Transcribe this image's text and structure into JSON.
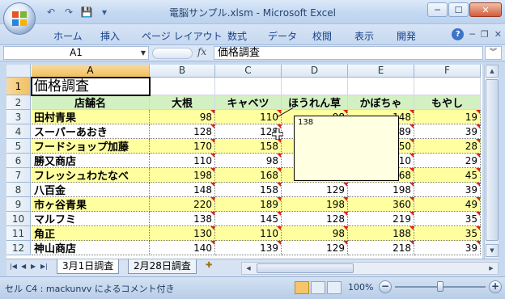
{
  "window": {
    "title": "電脳サンプル.xlsm - Microsoft Excel",
    "controls": {
      "minimize": "─",
      "maximize": "☐",
      "close": "✕"
    }
  },
  "quick_access": {
    "undo": "↶",
    "redo": "↷",
    "save": "💾"
  },
  "ribbon": {
    "tabs": [
      "ホーム",
      "挿入",
      "ページ レイアウト",
      "数式",
      "データ",
      "校閲",
      "表示",
      "開発"
    ],
    "help": "?"
  },
  "formula_bar": {
    "name_box": "A1",
    "fx": "fx",
    "content": "価格調査"
  },
  "sheet": {
    "columns": [
      "A",
      "B",
      "C",
      "D",
      "E",
      "F"
    ],
    "rows": [
      "1",
      "2",
      "3",
      "4",
      "5",
      "6",
      "7",
      "8",
      "9",
      "10",
      "11",
      "12"
    ],
    "title": "価格調査",
    "headers": [
      "店舗名",
      "大根",
      "キャベツ",
      "ほうれん草",
      "かぼちゃ",
      "もやし"
    ],
    "data": [
      {
        "store": "田村青果",
        "values": [
          "98",
          "110",
          "98",
          "148",
          "19"
        ]
      },
      {
        "store": "スーパーあおき",
        "values": [
          "128",
          "128",
          "",
          "189",
          "39"
        ]
      },
      {
        "store": "フードショップ加藤",
        "values": [
          "170",
          "158",
          "",
          "250",
          "28"
        ]
      },
      {
        "store": "勝又商店",
        "values": [
          "110",
          "98",
          "",
          "210",
          "29"
        ]
      },
      {
        "store": "フレッシュわたなべ",
        "values": [
          "198",
          "168",
          "",
          "168",
          "45"
        ]
      },
      {
        "store": "八百金",
        "values": [
          "148",
          "158",
          "129",
          "198",
          "39"
        ]
      },
      {
        "store": "市ヶ谷青果",
        "values": [
          "220",
          "189",
          "198",
          "360",
          "49"
        ]
      },
      {
        "store": "マルフミ",
        "values": [
          "138",
          "145",
          "128",
          "219",
          "35"
        ]
      },
      {
        "store": "角正",
        "values": [
          "130",
          "110",
          "98",
          "188",
          "35"
        ]
      },
      {
        "store": "神山商店",
        "values": [
          "140",
          "139",
          "129",
          "218",
          "39"
        ]
      }
    ]
  },
  "comment": {
    "text": "138"
  },
  "sheet_tabs": [
    "3月1日調査",
    "2月28日調査"
  ],
  "status": {
    "message": "セル C4 : mackunvv によるコメント付き",
    "zoom": "100%",
    "zoom_level": 0.5
  }
}
